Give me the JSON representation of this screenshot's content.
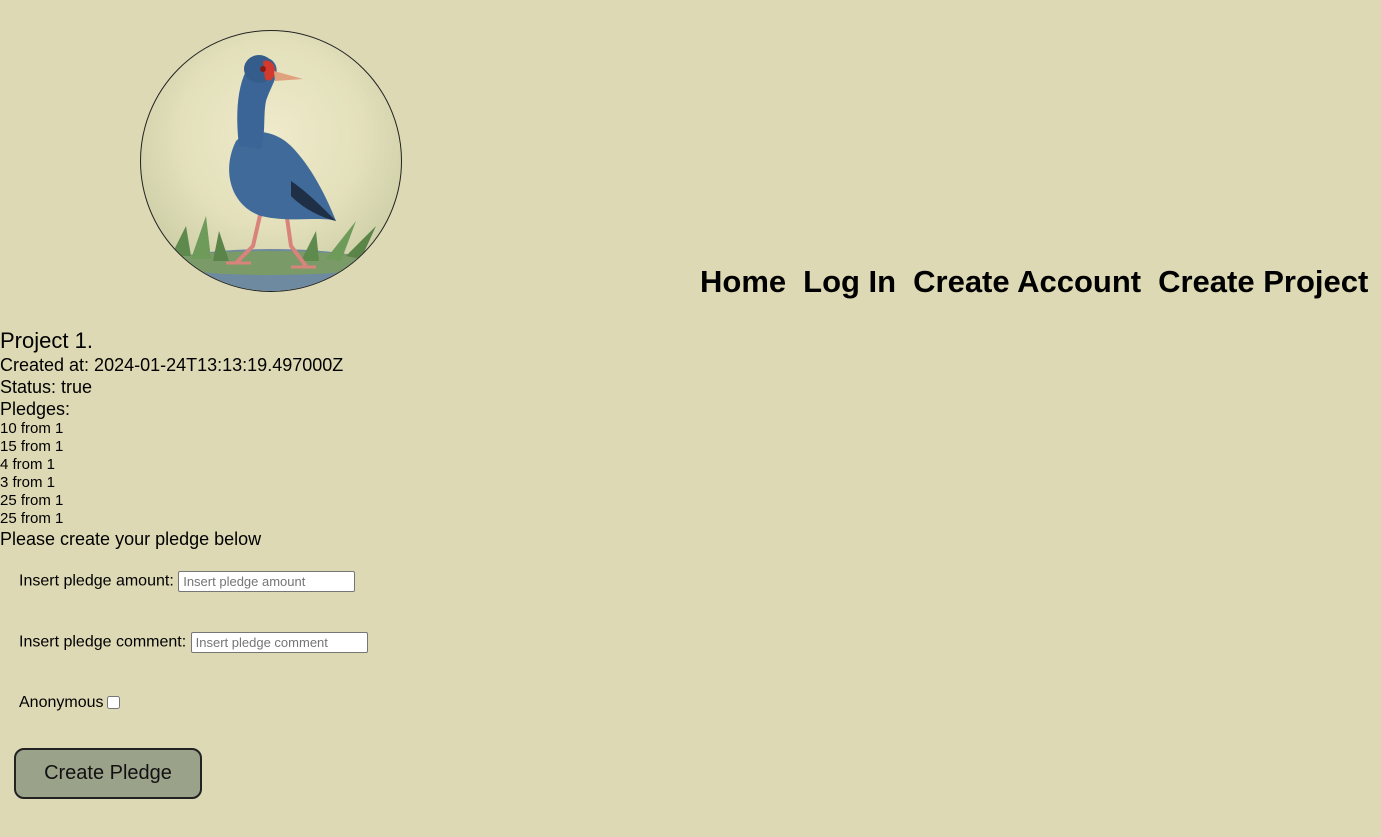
{
  "nav": {
    "home": "Home",
    "login": "Log In",
    "create_account": "Create Account",
    "create_project": "Create Project"
  },
  "project": {
    "title": "Project 1.",
    "created_at": "Created at: 2024-01-24T13:13:19.497000Z",
    "status": "Status: true",
    "pledges_label": "Pledges:",
    "pledges": [
      "10 from 1",
      "15 from 1",
      "4 from 1",
      "3 from 1",
      "25 from 1",
      "25 from 1"
    ]
  },
  "form": {
    "prompt": "Please create your pledge below",
    "amount_label": "Insert pledge amount:",
    "amount_placeholder": "Insert pledge amount",
    "amount_value": "",
    "comment_label": "Insert pledge comment:",
    "comment_placeholder": "Insert pledge comment",
    "comment_value": "",
    "anonymous_label": "Anonymous",
    "anonymous_checked": false,
    "submit_label": "Create Pledge"
  },
  "icons": {
    "logo": "pukeko-bird-logo"
  }
}
